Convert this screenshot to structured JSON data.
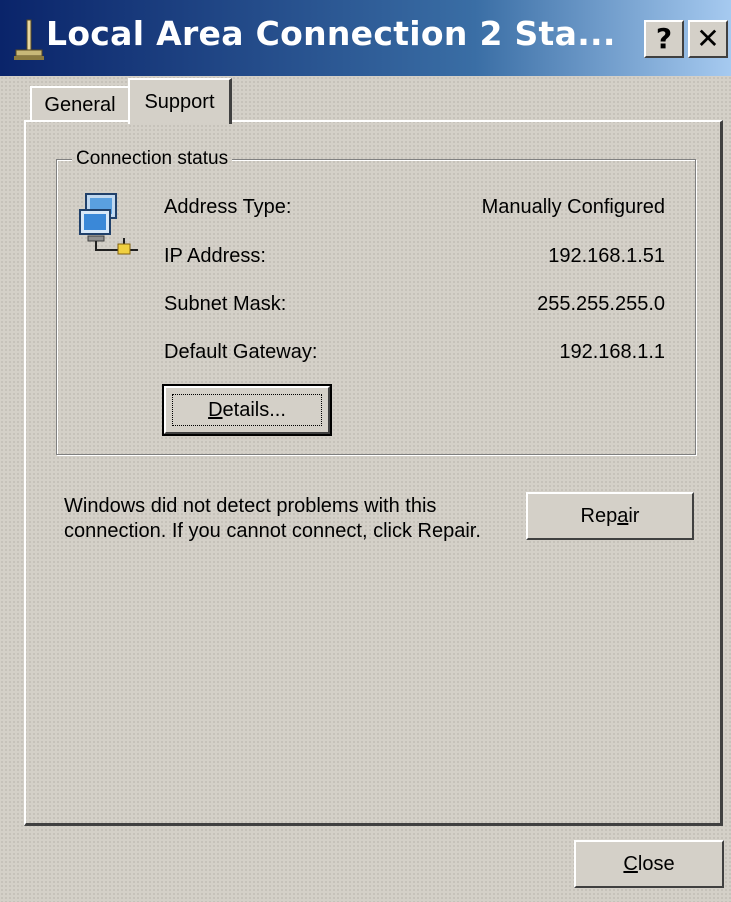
{
  "window": {
    "title": "Local Area Connection 2 Sta...",
    "help_button": "?",
    "close_button": "✕"
  },
  "tabs": [
    {
      "label": "General",
      "selected": false
    },
    {
      "label": "Support",
      "selected": true
    }
  ],
  "connection_status": {
    "legend": "Connection status",
    "rows": [
      {
        "label": "Address Type:",
        "value": "Manually Configured"
      },
      {
        "label": "IP Address:",
        "value": "192.168.1.51"
      },
      {
        "label": "Subnet Mask:",
        "value": "255.255.255.0"
      },
      {
        "label": "Default Gateway:",
        "value": "192.168.1.1"
      }
    ],
    "details_button": {
      "pre": "",
      "accel": "D",
      "post": "etails..."
    }
  },
  "message": "Windows did not detect problems with this connection. If you cannot connect, click Repair.",
  "repair_button": {
    "pre": "Rep",
    "accel": "a",
    "post": "ir"
  },
  "close_button": {
    "pre": "",
    "accel": "C",
    "post": "lose"
  },
  "colors": {
    "titlebar_start": "#0a246a",
    "titlebar_end": "#a6caf0",
    "dialog_bg": "#d4d0c8"
  }
}
